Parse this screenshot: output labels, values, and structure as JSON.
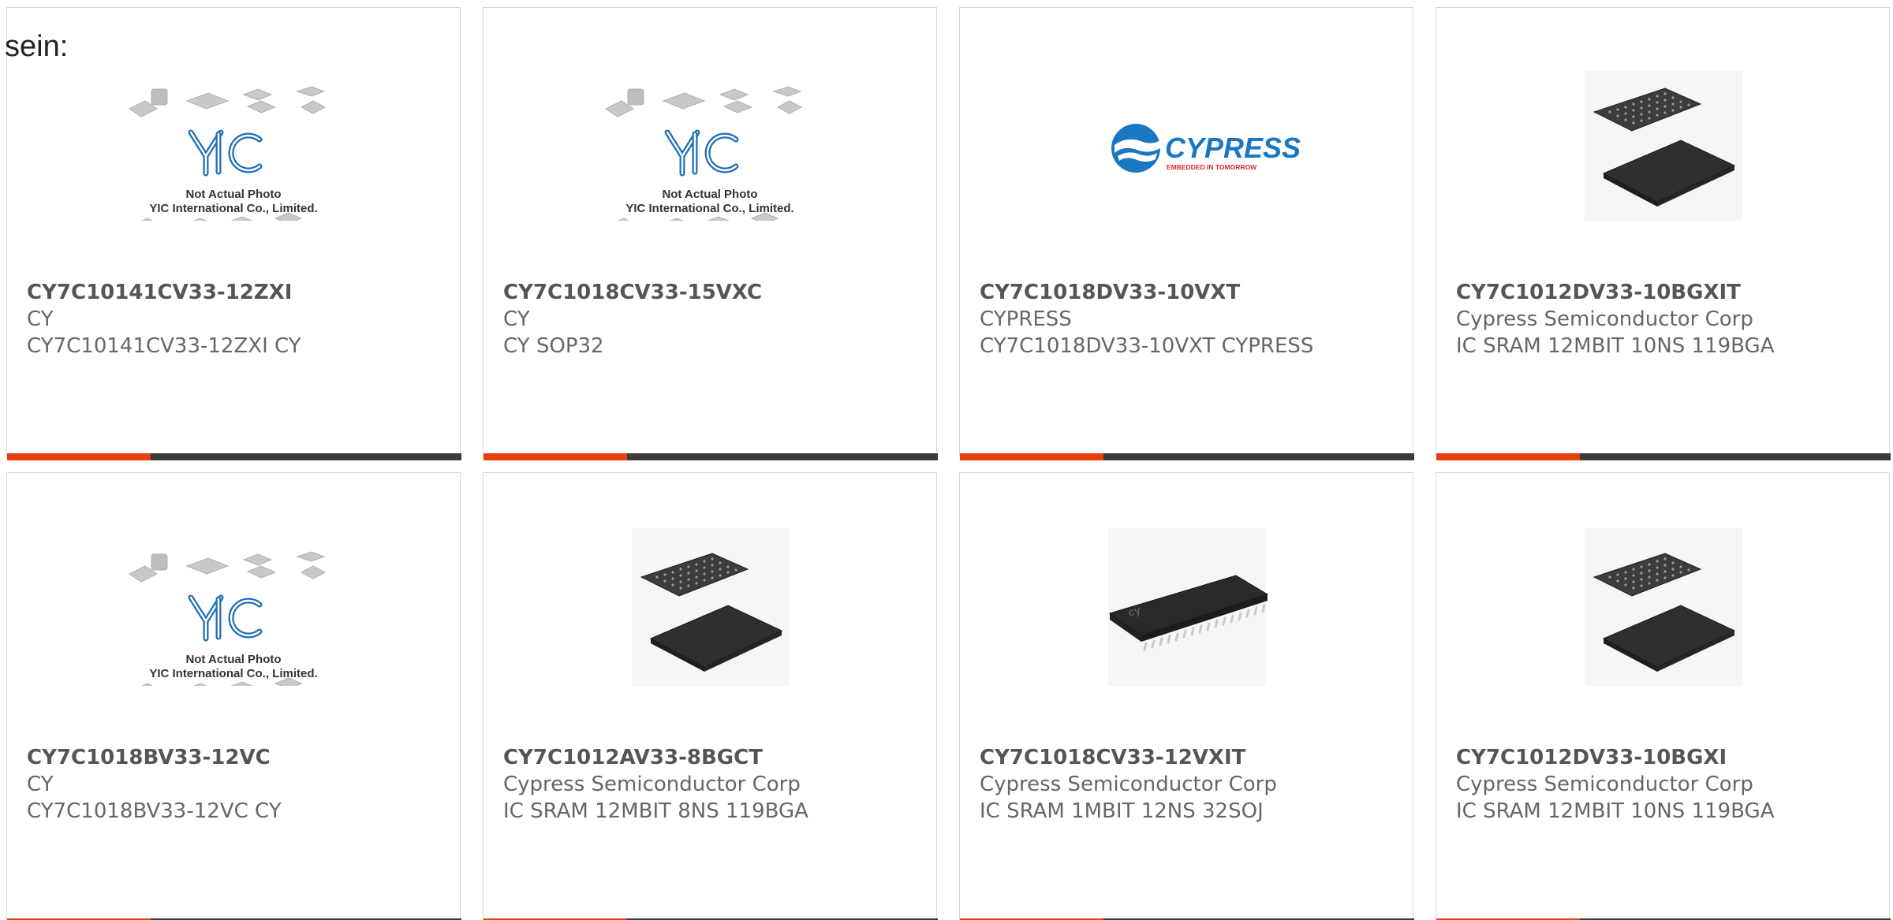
{
  "heading_fragment": "sein:",
  "colors": {
    "accent_bar": "#e8400c",
    "bar_dark": "#3a3a3a",
    "card_border": "#d7d7d7",
    "text_grey": "#666666",
    "yic_blue": "#1d6fb8",
    "cypress_blue": "#1a78c2",
    "cypress_red": "#d8282a"
  },
  "placeholder_image": {
    "logo_text": "YIC",
    "line1": "Not Actual Photo",
    "line2": "YIC International Co., Limited."
  },
  "cypress_logo": {
    "brand": "CYPRESS",
    "tagline": "EMBEDDED IN TOMORROW"
  },
  "products": [
    {
      "part_number": "CY7C10141CV33-12ZXI",
      "manufacturer": "CY",
      "description": "CY7C10141CV33-12ZXI CY",
      "image": "yic-placeholder"
    },
    {
      "part_number": "CY7C1018CV33-15VXC",
      "manufacturer": "CY",
      "description": "CY SOP32",
      "image": "yic-placeholder"
    },
    {
      "part_number": "CY7C1018DV33-10VXT",
      "manufacturer": "CYPRESS",
      "description": "CY7C1018DV33-10VXT CYPRESS",
      "image": "cypress-logo"
    },
    {
      "part_number": "CY7C1012DV33-10BGXIT",
      "manufacturer": "Cypress Semiconductor Corp",
      "description": "IC SRAM 12MBIT 10NS 119BGA",
      "image": "bga-chip"
    },
    {
      "part_number": "CY7C1018BV33-12VC",
      "manufacturer": "CY",
      "description": "CY7C1018BV33-12VC CY",
      "image": "yic-placeholder"
    },
    {
      "part_number": "CY7C1012AV33-8BGCT",
      "manufacturer": "Cypress Semiconductor Corp",
      "description": "IC SRAM 12MBIT 8NS 119BGA",
      "image": "bga-chip"
    },
    {
      "part_number": "CY7C1018CV33-12VXIT",
      "manufacturer": "Cypress Semiconductor Corp",
      "description": "IC SRAM 1MBIT 12NS 32SOJ",
      "image": "soj-chip"
    },
    {
      "part_number": "CY7C1012DV33-10BGXI",
      "manufacturer": "Cypress Semiconductor Corp",
      "description": "IC SRAM 12MBIT 10NS 119BGA",
      "image": "bga-chip"
    }
  ]
}
